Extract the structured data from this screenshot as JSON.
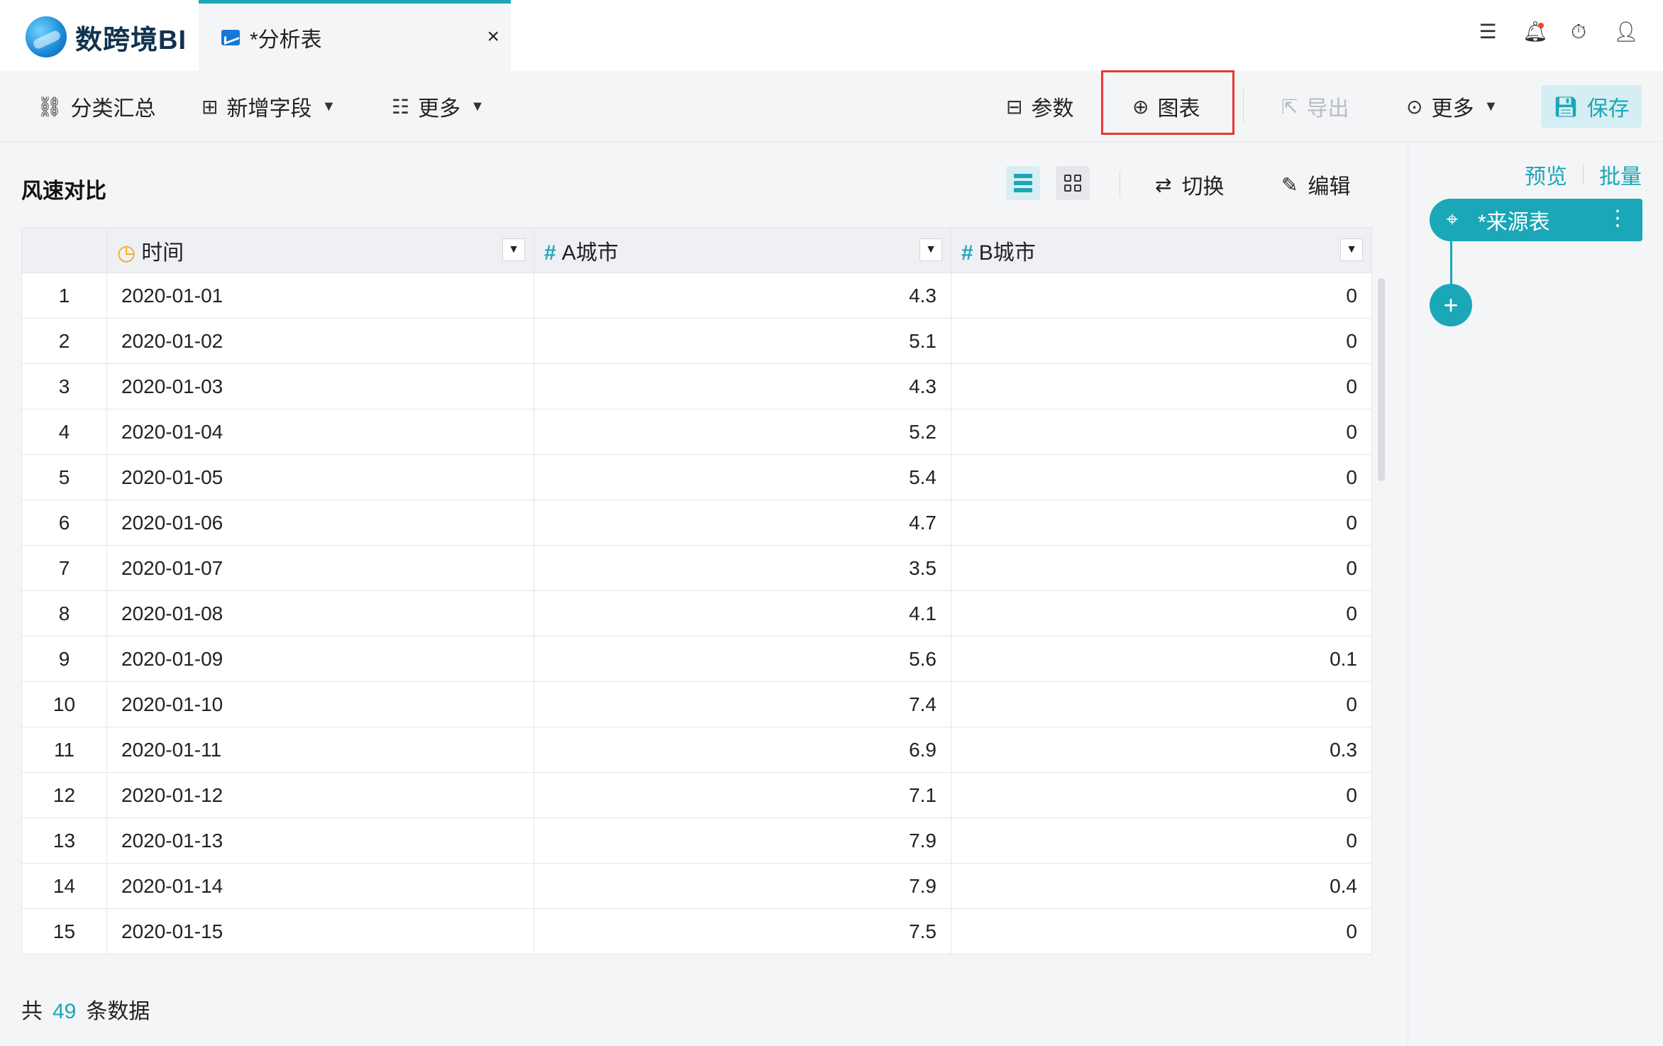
{
  "app": {
    "name": "数跨境BI"
  },
  "tab": {
    "label": "*分析表",
    "close": "×"
  },
  "top_icons": [
    "list-check-icon",
    "bell-icon",
    "timer-icon",
    "user-icon"
  ],
  "toolbar": {
    "group_summary": "分类汇总",
    "add_field": "新增字段",
    "more_left": "更多",
    "params": "参数",
    "chart": "图表",
    "export": "导出",
    "more_right": "更多",
    "save": "保存"
  },
  "sheet": {
    "title": "风速对比",
    "switch": "切换",
    "edit": "编辑"
  },
  "table": {
    "columns": [
      "时间",
      "A城市",
      "B城市"
    ],
    "rows": [
      [
        "1",
        "2020-01-01",
        "4.3",
        "0"
      ],
      [
        "2",
        "2020-01-02",
        "5.1",
        "0"
      ],
      [
        "3",
        "2020-01-03",
        "4.3",
        "0"
      ],
      [
        "4",
        "2020-01-04",
        "5.2",
        "0"
      ],
      [
        "5",
        "2020-01-05",
        "5.4",
        "0"
      ],
      [
        "6",
        "2020-01-06",
        "4.7",
        "0"
      ],
      [
        "7",
        "2020-01-07",
        "3.5",
        "0"
      ],
      [
        "8",
        "2020-01-08",
        "4.1",
        "0"
      ],
      [
        "9",
        "2020-01-09",
        "5.6",
        "0.1"
      ],
      [
        "10",
        "2020-01-10",
        "7.4",
        "0"
      ],
      [
        "11",
        "2020-01-11",
        "6.9",
        "0.3"
      ],
      [
        "12",
        "2020-01-12",
        "7.1",
        "0"
      ],
      [
        "13",
        "2020-01-13",
        "7.9",
        "0"
      ],
      [
        "14",
        "2020-01-14",
        "7.9",
        "0.4"
      ],
      [
        "15",
        "2020-01-15",
        "7.5",
        "0"
      ]
    ]
  },
  "footer": {
    "prefix": "共",
    "count": "49",
    "suffix": "条数据"
  },
  "right_panel": {
    "preview": "预览",
    "batch": "批量",
    "source_node": "*来源表",
    "add": "+"
  },
  "colors": {
    "accent": "#1aa7b8",
    "highlight": "#e53935"
  }
}
